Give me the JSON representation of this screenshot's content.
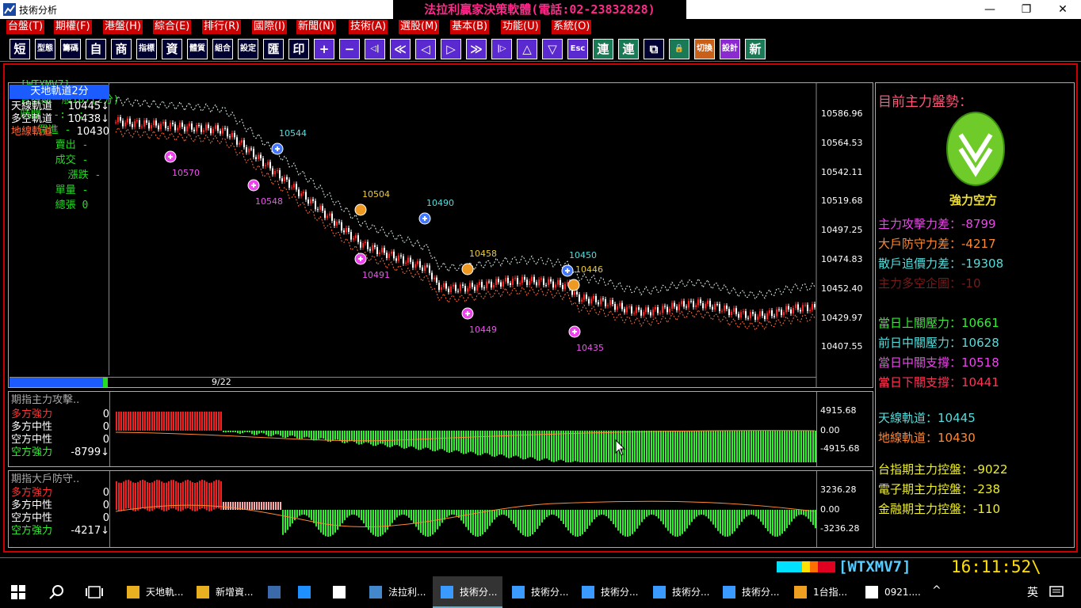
{
  "window": {
    "title": "技術分析",
    "banner": "法拉利贏家決策軟體(電話:02-23832828)",
    "min_glyph": "—",
    "max_glyph": "❐",
    "close_glyph": "✕"
  },
  "menu": [
    "台盤(T)",
    "期權(F)",
    "港盤(H)",
    "綜合(E)",
    "排行(R)",
    "國際(I)",
    "新聞(N)",
    "技術(A)",
    "選股(M)",
    "基本(B)",
    "功能(U)",
    "系統(O)"
  ],
  "toolbar": [
    "短",
    "型態",
    "籌碼",
    "自",
    "商",
    "指標",
    "資",
    "體質",
    "組合",
    "設定",
    "匯",
    "印",
    "+",
    "−",
    "◁|",
    "≪",
    "◁",
    "▷",
    "≫",
    "|▷",
    "△",
    "▽",
    "Esc",
    "連",
    "連",
    "⧉",
    "🔒",
    "切換",
    "設計",
    "新"
  ],
  "infobar": {
    "code": "[WTXMV7]",
    "name": "台指期一般107(2分)",
    "time_label": "時間 --:--:--",
    "buy_label": "買進 -",
    "sell_label": "賣出 -",
    "deal_label": "成交 -",
    "change_label": "漲跌 -",
    "vol_label": "單量 -",
    "total_label": "總張 0"
  },
  "main_legend": {
    "title": "天地軌道2分",
    "lines": [
      {
        "label": "天線軌道",
        "value": "10445↓",
        "color": "#ffffff"
      },
      {
        "label": "多空軌道",
        "value": "10438↓",
        "color": "#ffffff"
      },
      {
        "label": "地線軌道",
        "value": "10430",
        "color": "#ff6a3a"
      }
    ]
  },
  "price_axis": [
    "10586.96",
    "10564.53",
    "10542.11",
    "10519.68",
    "10497.25",
    "10474.83",
    "10452.40",
    "10429.97",
    "10407.55"
  ],
  "date_label": "9/22",
  "markers": [
    {
      "text": "10570",
      "color": "#ee55ee",
      "kind": "pink"
    },
    {
      "text": "10544",
      "color": "#55dddd",
      "kind": "blue"
    },
    {
      "text": "10548",
      "color": "#ee55ee",
      "kind": "pink"
    },
    {
      "text": "10504",
      "color": "#eecc33",
      "kind": "orange"
    },
    {
      "text": "10490",
      "color": "#55dddd",
      "kind": "blue"
    },
    {
      "text": "10491",
      "color": "#ee55ee",
      "kind": "pink"
    },
    {
      "text": "10458",
      "color": "#eecc33",
      "kind": "orange"
    },
    {
      "text": "10449",
      "color": "#ee55ee",
      "kind": "pink"
    },
    {
      "text": "10450",
      "color": "#55dddd",
      "kind": "blue"
    },
    {
      "text": "10446",
      "color": "#eecc33",
      "kind": "orange"
    },
    {
      "text": "10435",
      "color": "#ee55ee",
      "kind": "pink"
    }
  ],
  "sub1": {
    "title": "期指主力攻擊..",
    "lines": [
      {
        "label": "多方強力",
        "value": "0",
        "color": "#ff3333"
      },
      {
        "label": "多方中性",
        "value": "0",
        "color": "#ffffff"
      },
      {
        "label": "空方中性",
        "value": "0",
        "color": "#ffffff"
      },
      {
        "label": "空方強力",
        "value": "-8799↓",
        "color": "#33ee33"
      }
    ],
    "axis": [
      "4915.68",
      "0.00",
      "-4915.68"
    ]
  },
  "sub2": {
    "title": "期指大戶防守..",
    "lines": [
      {
        "label": "多方強力",
        "value": "0",
        "color": "#ff3333"
      },
      {
        "label": "多方中性",
        "value": "0",
        "color": "#ffffff"
      },
      {
        "label": "空方中性",
        "value": "0",
        "color": "#ffffff"
      },
      {
        "label": "空方強力",
        "value": "-4217↓",
        "color": "#33ee33"
      }
    ],
    "axis": [
      "3236.28",
      "0.00",
      "-3236.28"
    ]
  },
  "side": {
    "heading": "目前主力盤勢：",
    "trend": "強力空方",
    "items": [
      {
        "label": "主力攻擊力差：",
        "value": "-8799",
        "color": "#ee44ee"
      },
      {
        "label": "大戶防守力差：",
        "value": "-4217",
        "color": "#ff8833"
      },
      {
        "label": "散戶追價力差：",
        "value": "-19308",
        "color": "#55dddd"
      },
      {
        "label": "主力多空企圖：",
        "value": "-10",
        "color": "#7a1a1a"
      },
      {
        "label": "當日上關壓力：",
        "value": "10661",
        "color": "#33ee33"
      },
      {
        "label": "前日中關壓力：",
        "value": "10628",
        "color": "#55dddd"
      },
      {
        "label": "當日中關支撐：",
        "value": "10518",
        "color": "#ee44ee"
      },
      {
        "label": "當日下關支撐：",
        "value": "10441",
        "color": "#ff3355"
      },
      {
        "label": "天線軌道：",
        "value": "10445",
        "color": "#55dddd"
      },
      {
        "label": "地線軌道：",
        "value": "10430",
        "color": "#ff8833"
      },
      {
        "label": "台指期主力控盤：",
        "value": "-9022",
        "color": "#eeee33"
      },
      {
        "label": "電子期主力控盤：",
        "value": "-238",
        "color": "#eeee33"
      },
      {
        "label": "金融期主力控盤：",
        "value": "-110",
        "color": "#eeee33"
      }
    ]
  },
  "status": {
    "code": "[WTXMV7]",
    "clock": "16:11:52\\"
  },
  "taskbar": {
    "items": [
      "天地軌...",
      "新增資...",
      "",
      "",
      "",
      "法拉利...",
      "技術分...",
      "技術分...",
      "技術分...",
      "技術分...",
      "技術分...",
      "1台指...",
      "0921...."
    ],
    "ime": "英",
    "tray_arrow": "^"
  }
}
